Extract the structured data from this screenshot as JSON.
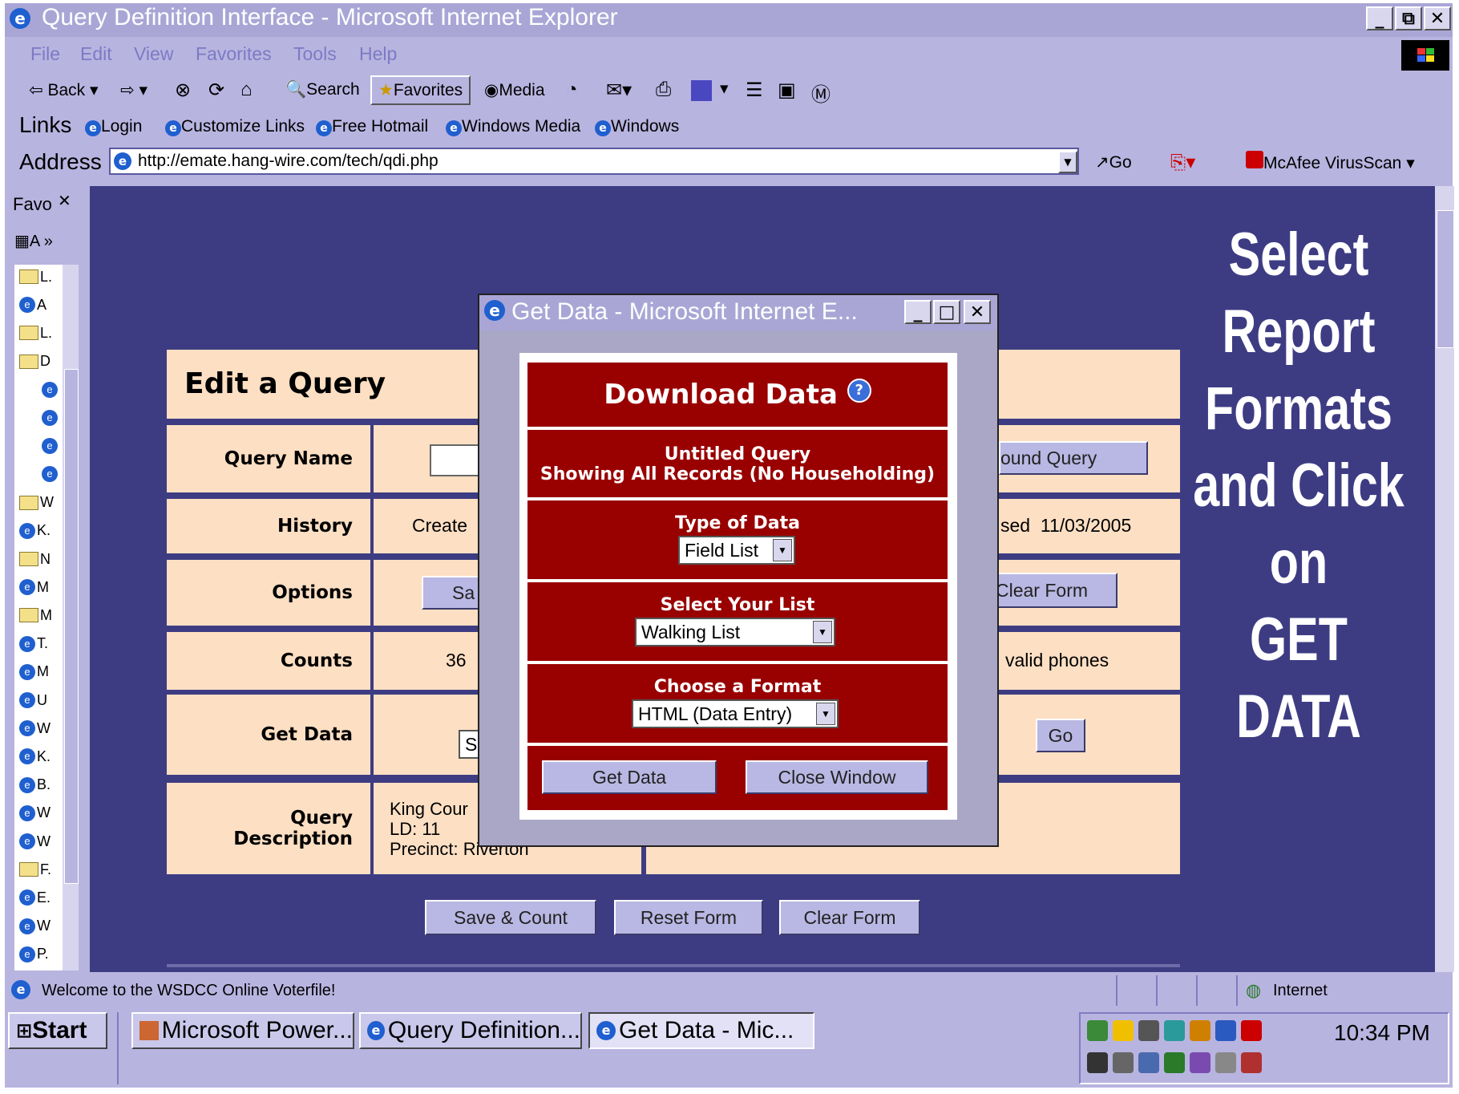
{
  "window": {
    "title": "Query Definition Interface - Microsoft Internet Explorer",
    "controls": [
      "_",
      "⧉",
      "✕"
    ]
  },
  "menu": [
    "File",
    "Edit",
    "View",
    "Favorites",
    "Tools",
    "Help"
  ],
  "toolbar": {
    "back": "Back",
    "search": "Search",
    "favorites": "Favorites",
    "media": "Media"
  },
  "links": {
    "label": "Links",
    "items": [
      "Login",
      "Customize Links",
      "Free Hotmail",
      "Windows Media",
      "Windows"
    ]
  },
  "address": {
    "label": "Address",
    "url": "http://emate.hang-wire.com/tech/qdi.php",
    "go": "Go",
    "mcafee": "McAfee VirusScan"
  },
  "favorites_pane": {
    "title": "Favo",
    "add": "A",
    "items": [
      "L.",
      "A",
      "L.",
      "D",
      "",
      "",
      "",
      "",
      "W",
      "K.",
      "N",
      "M",
      "M",
      "T.",
      "M",
      "U",
      "W",
      "K.",
      "B.",
      "W",
      "W",
      "F.",
      "E.",
      "W",
      "P."
    ]
  },
  "form": {
    "heading": "Edit a Query",
    "rows": {
      "query_name": "Query Name",
      "history": "History",
      "history_created": "Create",
      "history_used": "sed  11/03/2005",
      "options": "Options",
      "options_save": "Sa",
      "options_clear": "Clear Form",
      "compound_query": "ound Query",
      "counts": "Counts",
      "counts_value": "36",
      "counts_phones": "valid phones",
      "get_data": "Get Data",
      "get_data_select": "S",
      "go_button": "Go",
      "query_description": "Query Description",
      "desc_line1": "King Cour",
      "desc_line2": "LD: 11",
      "desc_line3": "Precinct: Riverton"
    },
    "bottom_buttons": [
      "Save & Count",
      "Reset Form",
      "Clear Form"
    ]
  },
  "overlay_annotation": [
    "Select",
    "Report Formats",
    "and Click on",
    "GET DATA"
  ],
  "popup": {
    "title": "Get Data - Microsoft Internet E...",
    "heading": "Download Data",
    "help_icon": "?",
    "query_title": "Untitled Query",
    "query_subtitle": "Showing All Records (No Householding)",
    "type_label": "Type of Data",
    "type_value": "Field List",
    "list_label": "Select Your List",
    "list_value": "Walking List",
    "format_label": "Choose a Format",
    "format_value": "HTML (Data Entry)",
    "get_data_button": "Get Data",
    "close_button": "Close Window"
  },
  "status": {
    "text": "Welcome to the WSDCC Online Voterfile!",
    "zone": "Internet"
  },
  "taskbar": {
    "start": "Start",
    "tasks": [
      "Microsoft Power...",
      "Query Definition...",
      "Get Data - Mic..."
    ],
    "clock": "10:34 PM"
  },
  "colors": {
    "titlebar": "#a9a6d6",
    "chrome": "#b8b4e0",
    "content_bg": "#3d3c83",
    "form_bg": "#fddfc3",
    "dialog_red": "#990000",
    "button": "#b9b7e3"
  }
}
